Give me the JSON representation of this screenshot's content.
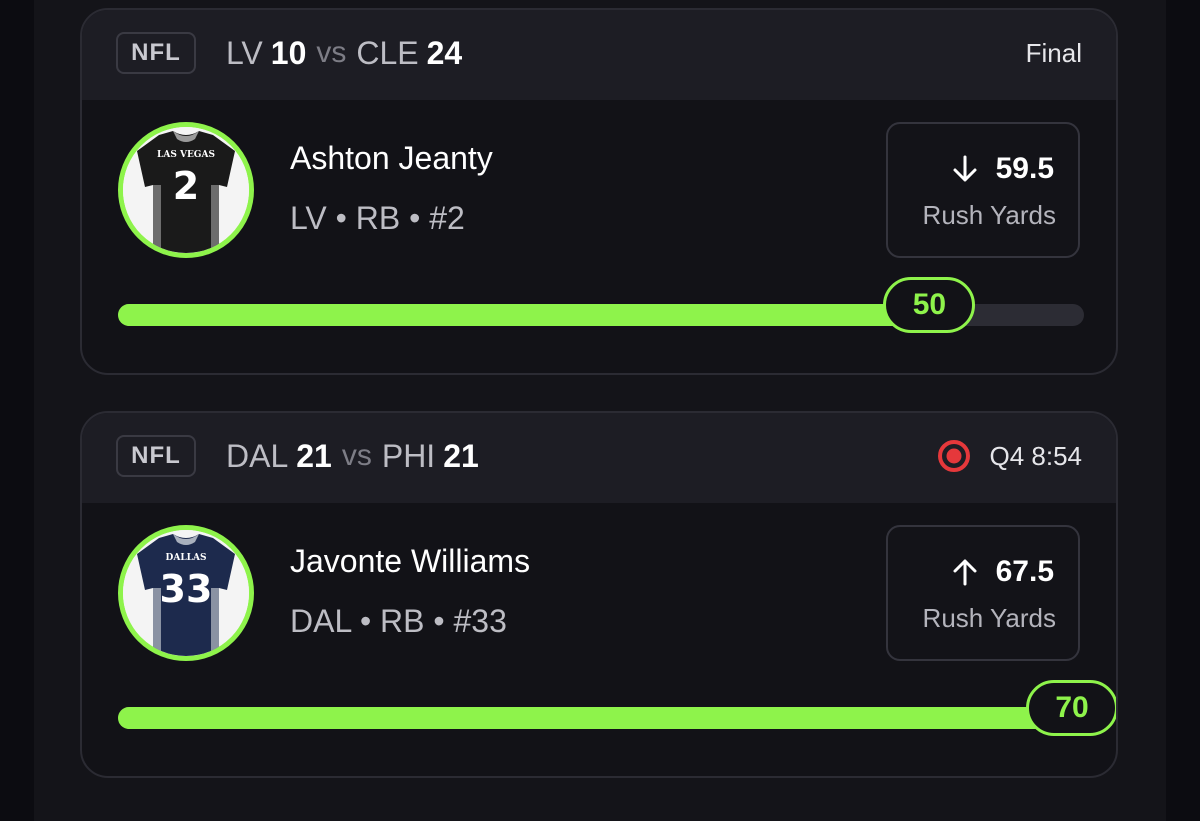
{
  "cards": [
    {
      "league": "NFL",
      "away_team": "LV",
      "away_score": "10",
      "vs": "vs",
      "home_team": "CLE",
      "home_score": "24",
      "status": "Final",
      "live": false,
      "player": {
        "name": "Ashton Jeanty",
        "meta": "LV • RB • #2",
        "jersey_text": "LAS VEGAS",
        "jersey_number": "2",
        "jersey_color": "#1a1a1a"
      },
      "prop": {
        "direction": "down",
        "icon": "arrow-down-icon",
        "line": "59.5",
        "stat": "Rush Yards"
      },
      "progress": {
        "value": "50",
        "fraction": 0.84
      }
    },
    {
      "league": "NFL",
      "away_team": "DAL",
      "away_score": "21",
      "vs": "vs",
      "home_team": "PHI",
      "home_score": "21",
      "status": "Q4 8:54",
      "live": true,
      "player": {
        "name": "Javonte Williams",
        "meta": "DAL • RB • #33",
        "jersey_text": "DALLAS",
        "jersey_number": "33",
        "jersey_color": "#1d2a4d"
      },
      "prop": {
        "direction": "up",
        "icon": "arrow-up-icon",
        "line": "67.5",
        "stat": "Rush Yards"
      },
      "progress": {
        "value": "70",
        "fraction": 1.0
      }
    }
  ],
  "colors": {
    "accent": "#8ef34b",
    "live": "#e5383b"
  }
}
